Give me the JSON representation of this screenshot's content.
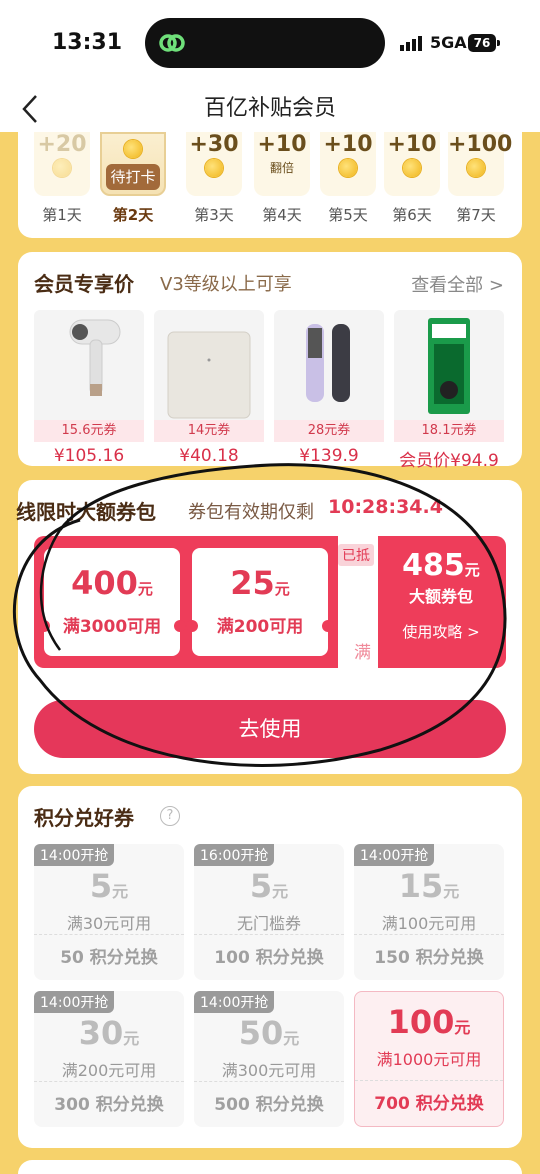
{
  "status": {
    "time": "13:31",
    "network": "5GA",
    "battery": "76"
  },
  "nav": {
    "title": "百亿补贴会员"
  },
  "checkin": {
    "days": [
      {
        "amount": "+20",
        "label": "第1天",
        "note": ""
      },
      {
        "amount": "",
        "label": "第2天",
        "badge": "待打卡"
      },
      {
        "amount": "+30",
        "label": "第3天",
        "note": ""
      },
      {
        "amount": "+10",
        "label": "第4天",
        "note": "翻倍"
      },
      {
        "amount": "+10",
        "label": "第5天",
        "note": ""
      },
      {
        "amount": "+10",
        "label": "第6天",
        "note": ""
      },
      {
        "amount": "+100",
        "label": "第7天",
        "note": ""
      }
    ]
  },
  "member": {
    "title": "会员专享价",
    "subtitle": "V3等级以上可享",
    "view_all": "查看全部 >",
    "products": [
      {
        "tag": "15.6元券",
        "price": "¥105.16"
      },
      {
        "tag": "14元券",
        "price": "¥40.18"
      },
      {
        "tag": "28元券",
        "price": "¥139.9"
      },
      {
        "tag": "18.1元券",
        "price": "会员价¥94.9"
      }
    ]
  },
  "pack": {
    "title": "线限时大额券包",
    "subtitle": "券包有效期仅剩",
    "countdown": "10:28:34.4",
    "coupons": [
      {
        "amount": "400",
        "unit": "元",
        "cond": "满3000可用"
      },
      {
        "amount": "25",
        "unit": "元",
        "cond": "满200可用"
      }
    ],
    "claimed_tag": "已抵",
    "claimed_cond": "满",
    "total": {
      "amount": "485",
      "unit": "元",
      "label": "大额券包",
      "guide": "使用攻略 >"
    },
    "button": "去使用"
  },
  "points": {
    "title": "积分兑好券",
    "coupons": [
      {
        "badge": "14:00开抢",
        "amount": "5",
        "unit": "元",
        "cond": "满30元可用",
        "cost": "50 积分兑换"
      },
      {
        "badge": "16:00开抢",
        "amount": "5",
        "unit": "元",
        "cond": "无门槛券",
        "cost": "100 积分兑换"
      },
      {
        "badge": "14:00开抢",
        "amount": "15",
        "unit": "元",
        "cond": "满100元可用",
        "cost": "150 积分兑换"
      },
      {
        "badge": "14:00开抢",
        "amount": "30",
        "unit": "元",
        "cond": "满200元可用",
        "cost": "300 积分兑换"
      },
      {
        "badge": "14:00开抢",
        "amount": "50",
        "unit": "元",
        "cond": "满300元可用",
        "cost": "500 积分兑换"
      },
      {
        "badge": "",
        "amount": "100",
        "unit": "元",
        "cond": "满1000元可用",
        "cost": "700 积分兑换"
      }
    ]
  },
  "colors": {
    "accent": "#e23b55",
    "background": "#f6d26b",
    "brown": "#4a2c14"
  }
}
